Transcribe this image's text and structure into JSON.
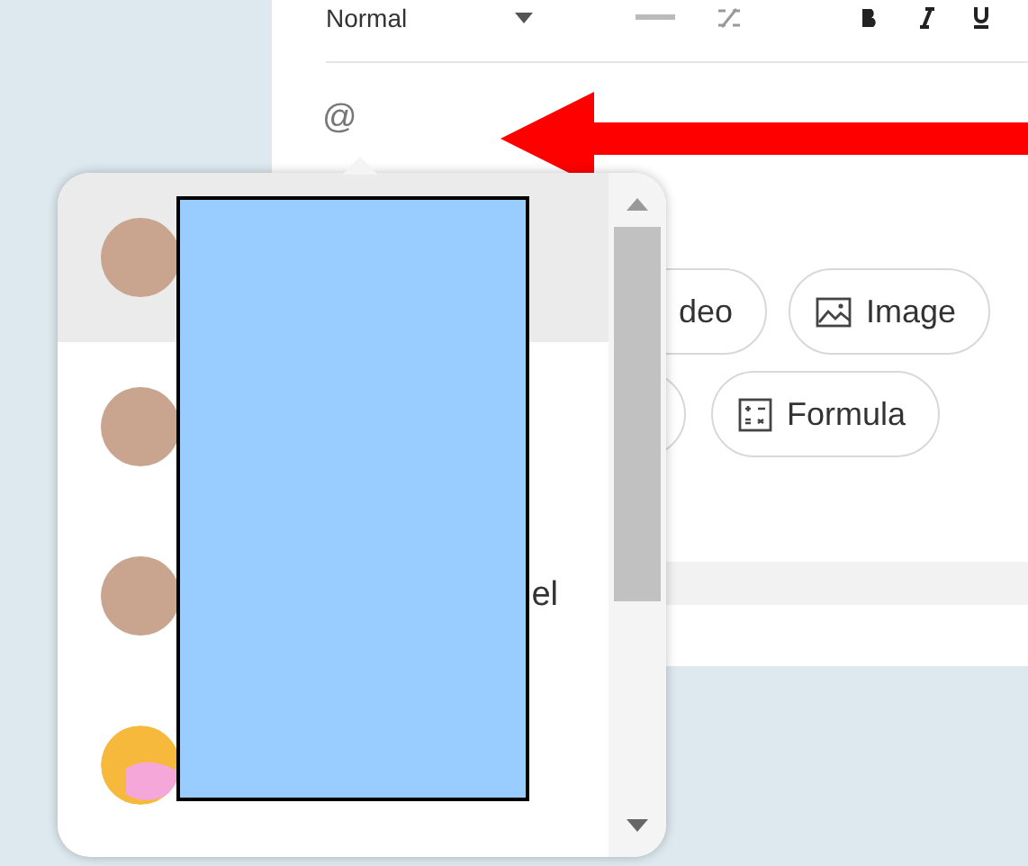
{
  "toolbar": {
    "style_select": "Normal"
  },
  "editor": {
    "text": "@"
  },
  "insert_buttons": [
    {
      "label": "deo",
      "kind": "plain"
    },
    {
      "label": "Image",
      "kind": "image"
    },
    {
      "kind": "blank"
    },
    {
      "label": "Formula",
      "kind": "formula"
    }
  ],
  "mention_list": {
    "items": [
      {
        "selected": true,
        "kind": "photo"
      },
      {
        "selected": false,
        "kind": "photo"
      },
      {
        "selected": false,
        "kind": "photo",
        "name": "el"
      },
      {
        "selected": false,
        "kind": "graphic"
      }
    ]
  }
}
